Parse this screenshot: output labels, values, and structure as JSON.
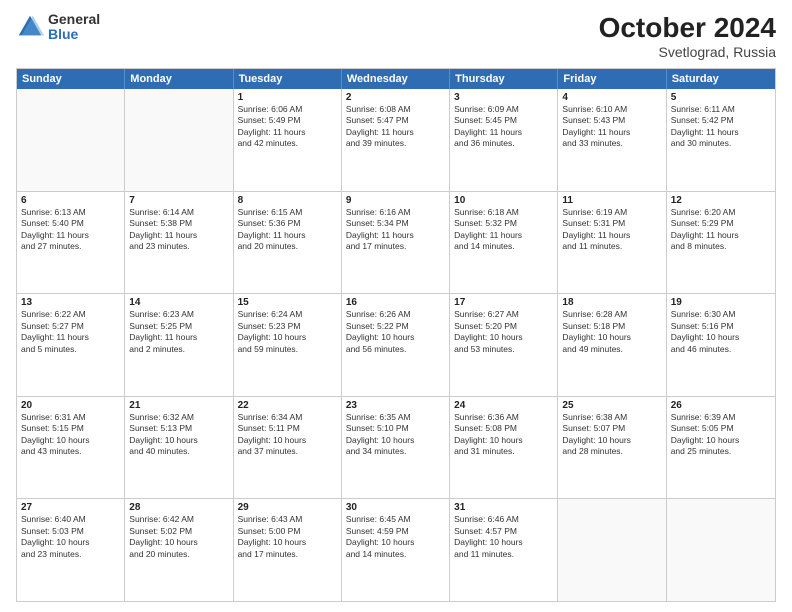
{
  "logo": {
    "general": "General",
    "blue": "Blue"
  },
  "title": {
    "month": "October 2024",
    "location": "Svetlograd, Russia"
  },
  "calendar": {
    "headers": [
      "Sunday",
      "Monday",
      "Tuesday",
      "Wednesday",
      "Thursday",
      "Friday",
      "Saturday"
    ],
    "rows": [
      [
        {
          "day": "",
          "lines": [],
          "empty": true
        },
        {
          "day": "",
          "lines": [],
          "empty": true
        },
        {
          "day": "1",
          "lines": [
            "Sunrise: 6:06 AM",
            "Sunset: 5:49 PM",
            "Daylight: 11 hours",
            "and 42 minutes."
          ]
        },
        {
          "day": "2",
          "lines": [
            "Sunrise: 6:08 AM",
            "Sunset: 5:47 PM",
            "Daylight: 11 hours",
            "and 39 minutes."
          ]
        },
        {
          "day": "3",
          "lines": [
            "Sunrise: 6:09 AM",
            "Sunset: 5:45 PM",
            "Daylight: 11 hours",
            "and 36 minutes."
          ]
        },
        {
          "day": "4",
          "lines": [
            "Sunrise: 6:10 AM",
            "Sunset: 5:43 PM",
            "Daylight: 11 hours",
            "and 33 minutes."
          ]
        },
        {
          "day": "5",
          "lines": [
            "Sunrise: 6:11 AM",
            "Sunset: 5:42 PM",
            "Daylight: 11 hours",
            "and 30 minutes."
          ]
        }
      ],
      [
        {
          "day": "6",
          "lines": [
            "Sunrise: 6:13 AM",
            "Sunset: 5:40 PM",
            "Daylight: 11 hours",
            "and 27 minutes."
          ]
        },
        {
          "day": "7",
          "lines": [
            "Sunrise: 6:14 AM",
            "Sunset: 5:38 PM",
            "Daylight: 11 hours",
            "and 23 minutes."
          ]
        },
        {
          "day": "8",
          "lines": [
            "Sunrise: 6:15 AM",
            "Sunset: 5:36 PM",
            "Daylight: 11 hours",
            "and 20 minutes."
          ]
        },
        {
          "day": "9",
          "lines": [
            "Sunrise: 6:16 AM",
            "Sunset: 5:34 PM",
            "Daylight: 11 hours",
            "and 17 minutes."
          ]
        },
        {
          "day": "10",
          "lines": [
            "Sunrise: 6:18 AM",
            "Sunset: 5:32 PM",
            "Daylight: 11 hours",
            "and 14 minutes."
          ]
        },
        {
          "day": "11",
          "lines": [
            "Sunrise: 6:19 AM",
            "Sunset: 5:31 PM",
            "Daylight: 11 hours",
            "and 11 minutes."
          ]
        },
        {
          "day": "12",
          "lines": [
            "Sunrise: 6:20 AM",
            "Sunset: 5:29 PM",
            "Daylight: 11 hours",
            "and 8 minutes."
          ]
        }
      ],
      [
        {
          "day": "13",
          "lines": [
            "Sunrise: 6:22 AM",
            "Sunset: 5:27 PM",
            "Daylight: 11 hours",
            "and 5 minutes."
          ]
        },
        {
          "day": "14",
          "lines": [
            "Sunrise: 6:23 AM",
            "Sunset: 5:25 PM",
            "Daylight: 11 hours",
            "and 2 minutes."
          ]
        },
        {
          "day": "15",
          "lines": [
            "Sunrise: 6:24 AM",
            "Sunset: 5:23 PM",
            "Daylight: 10 hours",
            "and 59 minutes."
          ]
        },
        {
          "day": "16",
          "lines": [
            "Sunrise: 6:26 AM",
            "Sunset: 5:22 PM",
            "Daylight: 10 hours",
            "and 56 minutes."
          ]
        },
        {
          "day": "17",
          "lines": [
            "Sunrise: 6:27 AM",
            "Sunset: 5:20 PM",
            "Daylight: 10 hours",
            "and 53 minutes."
          ]
        },
        {
          "day": "18",
          "lines": [
            "Sunrise: 6:28 AM",
            "Sunset: 5:18 PM",
            "Daylight: 10 hours",
            "and 49 minutes."
          ]
        },
        {
          "day": "19",
          "lines": [
            "Sunrise: 6:30 AM",
            "Sunset: 5:16 PM",
            "Daylight: 10 hours",
            "and 46 minutes."
          ]
        }
      ],
      [
        {
          "day": "20",
          "lines": [
            "Sunrise: 6:31 AM",
            "Sunset: 5:15 PM",
            "Daylight: 10 hours",
            "and 43 minutes."
          ]
        },
        {
          "day": "21",
          "lines": [
            "Sunrise: 6:32 AM",
            "Sunset: 5:13 PM",
            "Daylight: 10 hours",
            "and 40 minutes."
          ]
        },
        {
          "day": "22",
          "lines": [
            "Sunrise: 6:34 AM",
            "Sunset: 5:11 PM",
            "Daylight: 10 hours",
            "and 37 minutes."
          ]
        },
        {
          "day": "23",
          "lines": [
            "Sunrise: 6:35 AM",
            "Sunset: 5:10 PM",
            "Daylight: 10 hours",
            "and 34 minutes."
          ]
        },
        {
          "day": "24",
          "lines": [
            "Sunrise: 6:36 AM",
            "Sunset: 5:08 PM",
            "Daylight: 10 hours",
            "and 31 minutes."
          ]
        },
        {
          "day": "25",
          "lines": [
            "Sunrise: 6:38 AM",
            "Sunset: 5:07 PM",
            "Daylight: 10 hours",
            "and 28 minutes."
          ]
        },
        {
          "day": "26",
          "lines": [
            "Sunrise: 6:39 AM",
            "Sunset: 5:05 PM",
            "Daylight: 10 hours",
            "and 25 minutes."
          ]
        }
      ],
      [
        {
          "day": "27",
          "lines": [
            "Sunrise: 6:40 AM",
            "Sunset: 5:03 PM",
            "Daylight: 10 hours",
            "and 23 minutes."
          ]
        },
        {
          "day": "28",
          "lines": [
            "Sunrise: 6:42 AM",
            "Sunset: 5:02 PM",
            "Daylight: 10 hours",
            "and 20 minutes."
          ]
        },
        {
          "day": "29",
          "lines": [
            "Sunrise: 6:43 AM",
            "Sunset: 5:00 PM",
            "Daylight: 10 hours",
            "and 17 minutes."
          ]
        },
        {
          "day": "30",
          "lines": [
            "Sunrise: 6:45 AM",
            "Sunset: 4:59 PM",
            "Daylight: 10 hours",
            "and 14 minutes."
          ]
        },
        {
          "day": "31",
          "lines": [
            "Sunrise: 6:46 AM",
            "Sunset: 4:57 PM",
            "Daylight: 10 hours",
            "and 11 minutes."
          ]
        },
        {
          "day": "",
          "lines": [],
          "empty": true
        },
        {
          "day": "",
          "lines": [],
          "empty": true
        }
      ]
    ]
  }
}
